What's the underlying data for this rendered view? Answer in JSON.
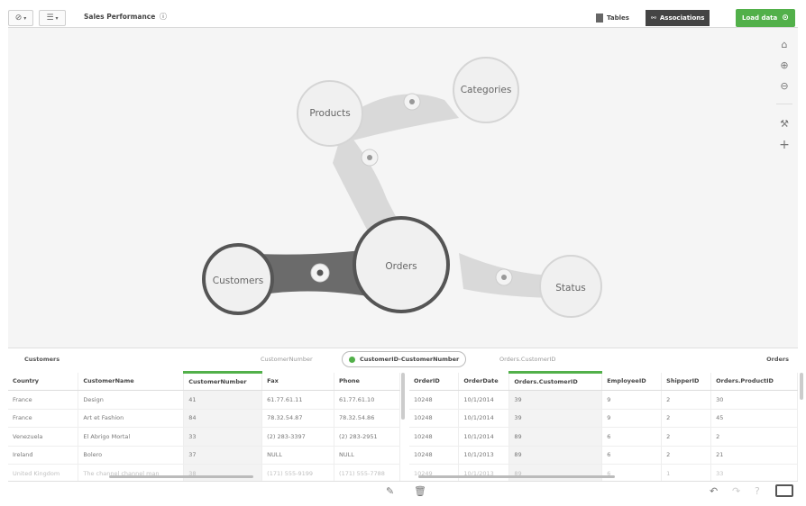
{
  "toolbar": {
    "global_menu_icon": "global-menu",
    "list_menu_icon": "list-menu",
    "app_title": "Sales Performance",
    "tables_label": "Tables",
    "associations_label": "Associations",
    "load_data_label": "Load data"
  },
  "model": {
    "tables": [
      {
        "name": "Products"
      },
      {
        "name": "Categories"
      },
      {
        "name": "Customers"
      },
      {
        "name": "Orders"
      },
      {
        "name": "Status"
      }
    ],
    "tools": [
      "home-icon",
      "zoom-in-icon",
      "zoom-out-icon",
      "magic-wand-icon",
      "add-icon"
    ]
  },
  "association": {
    "left_table": "Customers",
    "left_field": "CustomerNumber",
    "key_label": "CustomerID-CustomerNumber",
    "right_field": "Orders.CustomerID",
    "right_table": "Orders"
  },
  "customers_table": {
    "columns": [
      "Country",
      "CustomerName",
      "CustomerNumber",
      "Fax",
      "Phone"
    ],
    "rows": [
      [
        "France",
        "Design",
        "41",
        "61.77.61.11",
        "61.77.61.10"
      ],
      [
        "France",
        "Art et Fashion",
        "84",
        "78.32.54.87",
        "78.32.54.86"
      ],
      [
        "Venezuela",
        "El Abrigo Mortal",
        "33",
        "(2) 283-3397",
        "(2) 283-2951"
      ],
      [
        "Ireland",
        "Bolero",
        "37",
        "NULL",
        "NULL"
      ],
      [
        "United Kingdom",
        "The channel channel man",
        "38",
        "(171) 555-9199",
        "(171) 555-7788"
      ]
    ]
  },
  "orders_table": {
    "columns": [
      "OrderID",
      "OrderDate",
      "Orders.CustomerID",
      "EmployeeID",
      "ShipperID",
      "Orders.ProductID"
    ],
    "rows": [
      [
        "10248",
        "10/1/2014",
        "39",
        "9",
        "2",
        "30"
      ],
      [
        "10248",
        "10/1/2014",
        "39",
        "9",
        "2",
        "45"
      ],
      [
        "10248",
        "10/1/2014",
        "89",
        "6",
        "2",
        "2"
      ],
      [
        "10248",
        "10/1/2013",
        "89",
        "6",
        "2",
        "21"
      ],
      [
        "10249",
        "10/1/2013",
        "89",
        "6",
        "1",
        "33"
      ]
    ]
  },
  "colors": {
    "accent": "#52b04a",
    "bubble_fill": "#f0f0f0",
    "link_light": "#d9d9d9",
    "link_dark": "#6b6b6b"
  }
}
